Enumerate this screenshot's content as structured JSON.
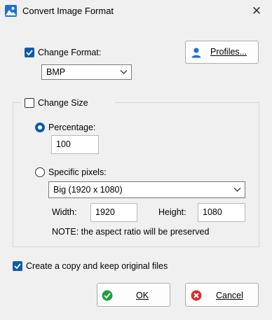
{
  "window": {
    "title": "Convert Image Format",
    "close_glyph": "✕"
  },
  "format": {
    "checkbox_label": "Change Format:",
    "checked": true,
    "selected": "BMP",
    "profiles_label": "Profiles..."
  },
  "size": {
    "checkbox_label": "Change Size",
    "checked": false,
    "percentage_label": "Percentage:",
    "percentage_value": "100",
    "percentage_selected": true,
    "pixels_label": "Specific pixels:",
    "preset_selected": "Big (1920 x 1080)",
    "width_label": "Width:",
    "width_value": "1920",
    "height_label": "Height:",
    "height_value": "1080",
    "note": "NOTE: the aspect ratio will be preserved"
  },
  "copy": {
    "label": "Create a copy and keep original files",
    "checked": true
  },
  "buttons": {
    "ok": "OK",
    "cancel": "Cancel"
  },
  "colors": {
    "accent": "#0b5cad",
    "ok_green": "#1e9e3e",
    "cancel_red": "#d9302c"
  }
}
